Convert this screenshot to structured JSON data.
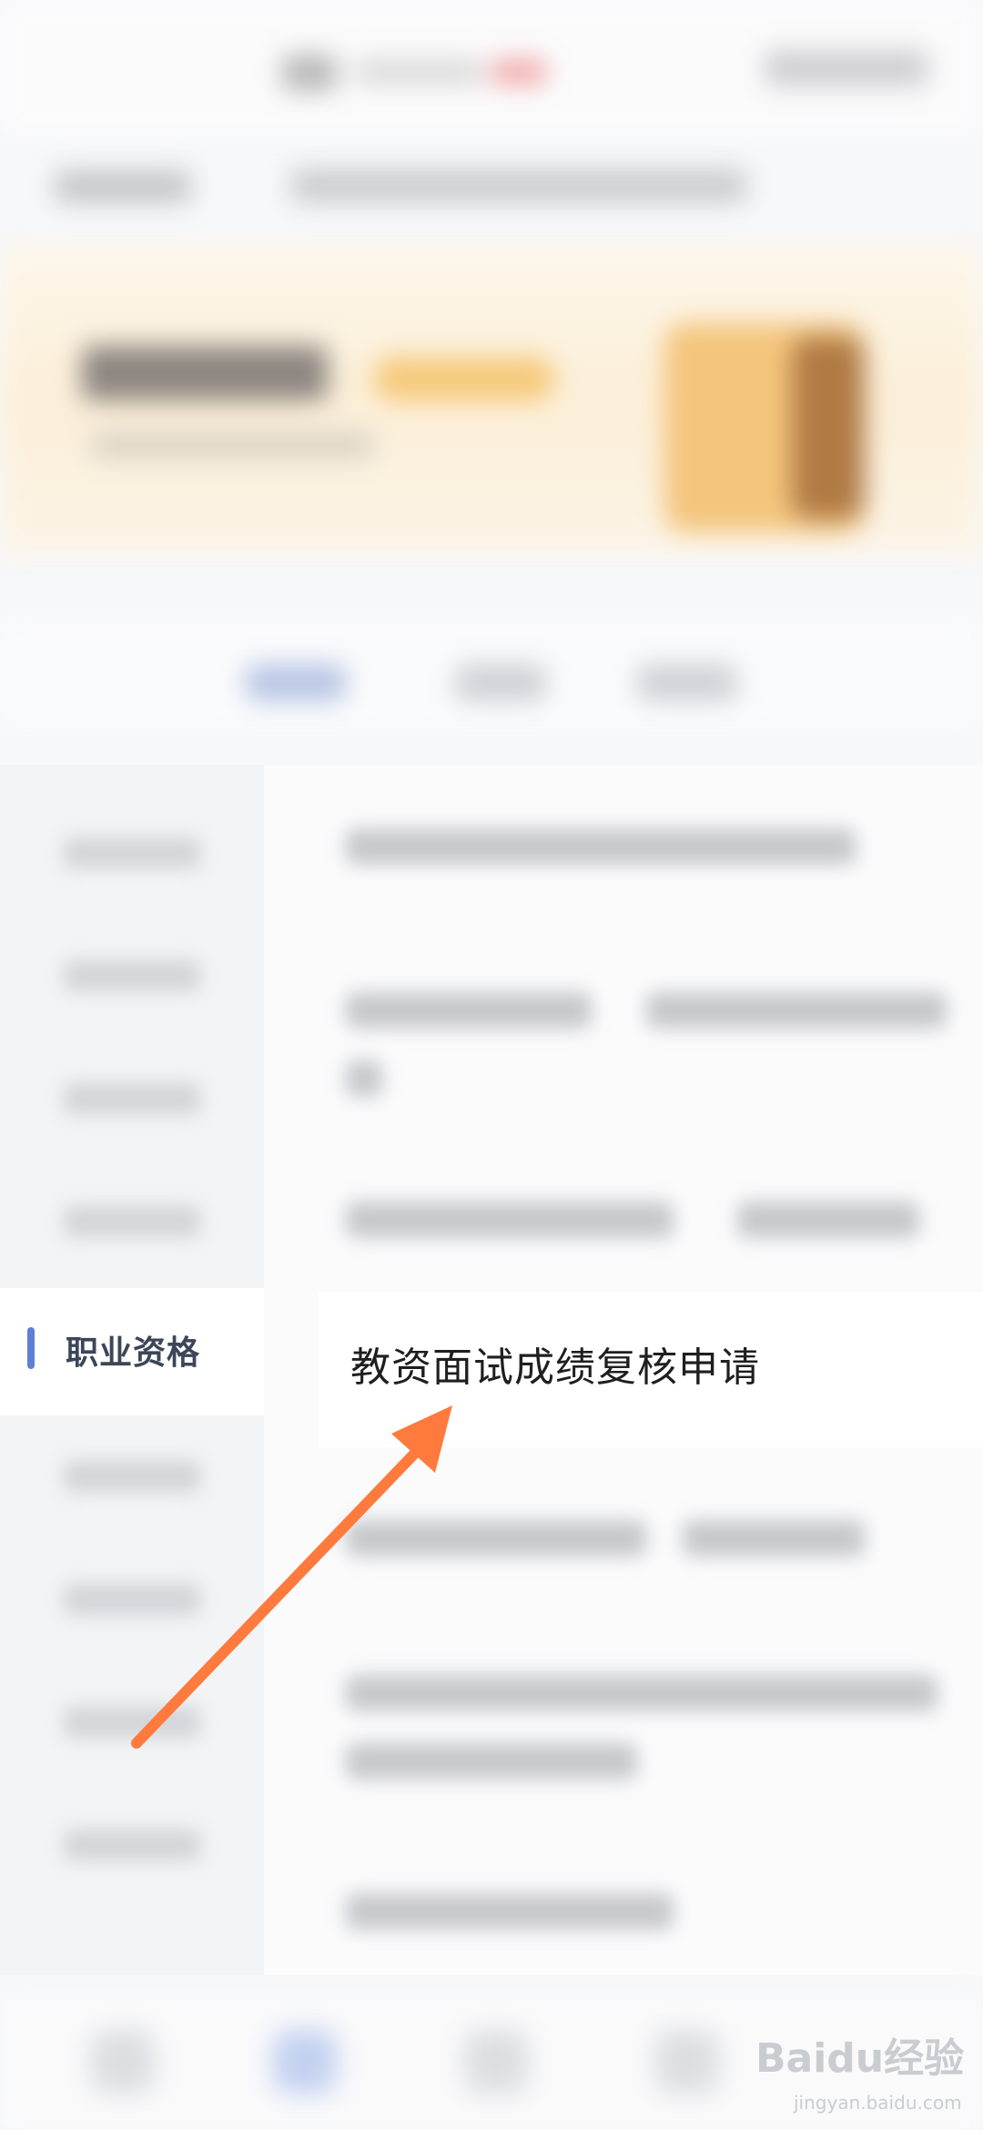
{
  "side_nav": {
    "active_label": "职业资格"
  },
  "content": {
    "highlighted_item": "教资面试成绩复核申请"
  },
  "watermark": {
    "main": "Baidu经验",
    "sub": "jingyan.baidu.com"
  },
  "annotation": {
    "arrow_color": "#ff7a3d"
  }
}
